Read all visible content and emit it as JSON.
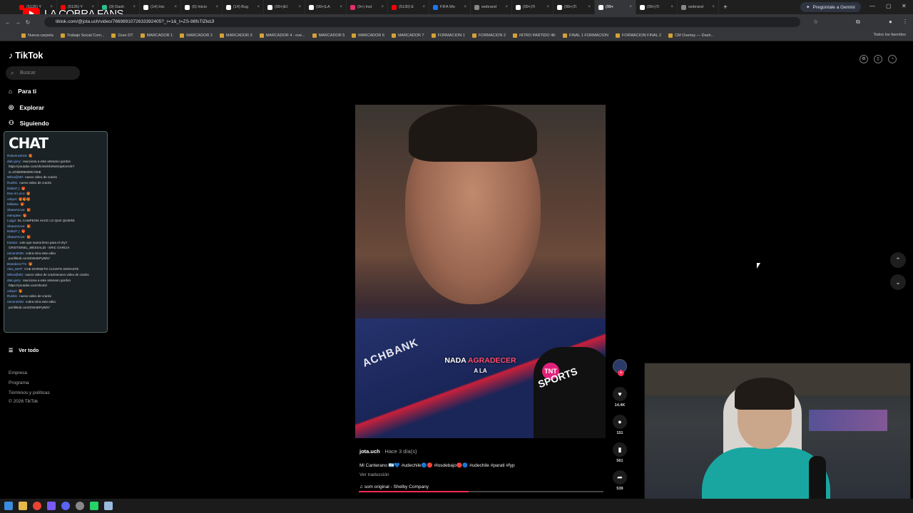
{
  "browser": {
    "tabs": [
      {
        "label": "(5126) Y",
        "color": "#ff0000"
      },
      {
        "label": "(5126) Y",
        "color": "#ff0000"
      },
      {
        "label": "(9) Dash",
        "color": "#2bbf8e"
      },
      {
        "label": "(14) Inic",
        "color": "#ffffff"
      },
      {
        "label": "(6) Inicio",
        "color": "#ffffff"
      },
      {
        "label": "(14) Bug",
        "color": "#ffffff"
      },
      {
        "label": "(99+)El",
        "color": "#ffffff"
      },
      {
        "label": "(99+)LA",
        "color": "#ffffff"
      },
      {
        "label": "(9+) Inst",
        "color": "#e1306c"
      },
      {
        "label": "(5130) E",
        "color": "#ff0000"
      },
      {
        "label": "FIFA Wo",
        "color": "#1877f2"
      },
      {
        "label": "webrand",
        "color": "#888888"
      },
      {
        "label": "(99+)Ti",
        "color": "#ffffff"
      },
      {
        "label": "(99+)Ti",
        "color": "#ffffff"
      },
      {
        "label": "(99+",
        "color": "#ffffff",
        "active": true
      },
      {
        "label": "(99+)Ti",
        "color": "#ffffff"
      },
      {
        "label": "webrand",
        "color": "#888888"
      }
    ],
    "new_tab": "+",
    "gemini_button": "Pregúntale a Gemini",
    "url": "tiktok.com/@jota.uch/video/7669891072633392405?_r=1&_t=ZS-98fsTlZkdJl",
    "bookmarks": [
      "Nueva carpeta",
      "Trabajo Social Com...",
      "Gran DT",
      "MARCADOR 1",
      "MARCADOR 2",
      "MARCADOR 3",
      "MARCADOR 4 - ove...",
      "MARCADOR 5",
      "MARCADOR 6",
      "MARCADOR 7",
      "FORMACION 1",
      "FORMACION 2",
      "INTRO PARTIDO 4K",
      "FINAL 1 FORMACION",
      "FORMACION FINAL 2",
      "CM Overlay — Dash..."
    ],
    "bookmarks_right": "Todos los favoritos"
  },
  "stream_overlay": {
    "title": "LA COBRA FANS",
    "chat_title": "CHAT",
    "chat_lines": [
      {
        "user": "Robenrosh19:",
        "text": "🎁"
      },
      {
        "user": "dato.jarry:",
        "text": "reacciona a este artesano gordon"
      },
      {
        "user": "",
        "text": "https://youtube.com/shorts/HbrNeGnpKnAVE?"
      },
      {
        "user": "",
        "text": "si=Ghkl9R9NhRkYb0E"
      },
      {
        "user": "Wilso@t20:",
        "text": "nuevo video de cracks"
      },
      {
        "user": "Rushi1:",
        "text": "nuevo video de cracks"
      },
      {
        "user": "Rafa37 j:",
        "text": "🎁"
      },
      {
        "user": "Dan el Loco:",
        "text": "🎁"
      },
      {
        "user": "Adryel:",
        "text": "🎁🎁🎁"
      },
      {
        "user": "Mikatsu:",
        "text": "🎁"
      },
      {
        "user": "ShaneVLive:",
        "text": "🎁"
      },
      {
        "user": "eternptee:",
        "text": "🎁"
      },
      {
        "user": "Luigyl:",
        "text": "EL CAMPEON HACE LO QUE QUIERE"
      },
      {
        "user": "ShaneVLive:",
        "text": "🎁"
      },
      {
        "user": "Rafa37 j:",
        "text": "🎁"
      },
      {
        "user": "ShaneVLive:",
        "text": "🎁"
      },
      {
        "user": "Kasuto:",
        "text": "vote que suena lleno para el city?"
      },
      {
        "user": "",
        "text": "CRISTIONEL_MESSALDI - ERIC GARCIA"
      },
      {
        "user": "ramon2025:",
        "text": "cobra mira este edito"
      },
      {
        "user": "",
        "text": "por/tiktok.com/ZS64DPy9dV/"
      },
      {
        "user": "Brandon1771:",
        "text": "🎁"
      },
      {
        "user": "Alex_MVP:",
        "text": "CHE DORSETO CUANTO DONASTE"
      },
      {
        "user": "Wilso@t20:",
        "text": "nuevo video de cracksnuevo video de cracks"
      },
      {
        "user": "dato.jarry:",
        "text": "reacciona a este artesano gordon"
      },
      {
        "user": "",
        "text": "https://youtube.com/shorts/"
      },
      {
        "user": "Adryel:",
        "text": "🎁"
      },
      {
        "user": "Rushi1:",
        "text": "nuevo video de cracks"
      },
      {
        "user": "ramon2025:",
        "text": "cobra mira este edito"
      },
      {
        "user": "",
        "text": "por/tiktok.com/ZS64DPy9dV/"
      }
    ]
  },
  "tiktok": {
    "logo": "TikTok",
    "search_placeholder": "Buscar",
    "nav": [
      {
        "label": "Para ti",
        "icon": "home-icon"
      },
      {
        "label": "Explorar",
        "icon": "compass-icon"
      },
      {
        "label": "Siguiendo",
        "icon": "following-icon"
      }
    ],
    "see_all": "Ver todo",
    "footer": [
      "Empresa",
      "Programa",
      "Términos y políticas",
      "© 2026 TikTok"
    ],
    "video": {
      "subtitle_word1": "NADA",
      "subtitle_word2": "AGRADECER",
      "subtitle_line2": "A LA",
      "sponsor": "ACHBANK",
      "broadcaster": "SPORTS",
      "broadcaster_logo": "TNT"
    },
    "actions": {
      "likes": "14.4K",
      "comments": "151",
      "saves": "561",
      "shares": "539"
    },
    "caption": {
      "user": "jota.uch",
      "when": " · Hace 3 día(s)",
      "description": "Mi Canterano 🇦🇷💙 #udechile🔵🔴 #losdebajo🔴🔵 #udechile #parati #fyp",
      "translate": "Ver traducción",
      "music": "som original - Shelby Company"
    },
    "progress": 0.45,
    "colors": {
      "accent": "#fe2c55",
      "background": "#000000"
    }
  }
}
